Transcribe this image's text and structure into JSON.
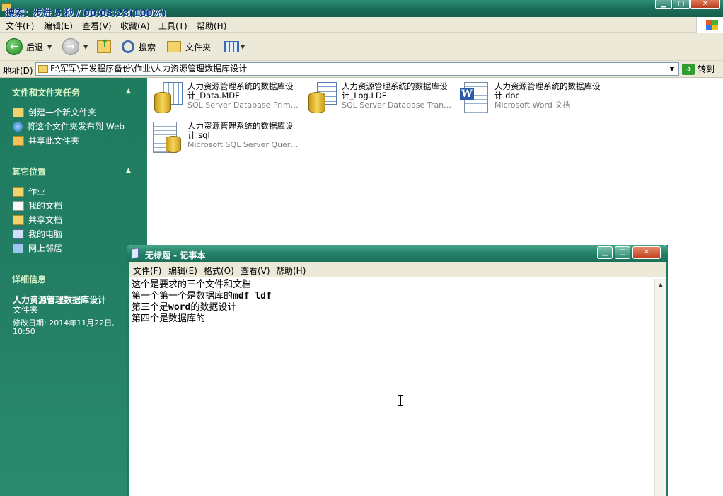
{
  "explorer": {
    "title": "搜索：步进 5 秒 / 00:03:23(100%)",
    "menu": [
      "文件(F)",
      "编辑(E)",
      "查看(V)",
      "收藏(A)",
      "工具(T)",
      "帮助(H)"
    ],
    "toolbar": {
      "back": "后退",
      "search": "搜索",
      "folders": "文件夹"
    },
    "address": {
      "label": "地址(D)",
      "path": "F:\\军军\\开发程序备份\\作业\\人力资源管理数据库设计",
      "go": "转到"
    }
  },
  "taskpane": {
    "file_tasks": {
      "title": "文件和文件夹任务",
      "items": [
        "创建一个新文件夹",
        "将这个文件夹发布到 Web",
        "共享此文件夹"
      ]
    },
    "other_places": {
      "title": "其它位置",
      "items": [
        "作业",
        "我的文档",
        "共享文档",
        "我的电脑",
        "网上邻居"
      ]
    },
    "details": {
      "title": "详细信息",
      "name": "人力资源管理数据库设计",
      "kind": "文件夹",
      "modified_1": "修改日期: 2014年11月22日,",
      "modified_2": "10:50"
    }
  },
  "files": [
    {
      "name_1": "人力资源管理系统的数据库设",
      "name_2": "计_Data.MDF",
      "type": "SQL Server Database Primary ...",
      "icon": "sql-database-icon"
    },
    {
      "name_1": "人力资源管理系统的数据库设",
      "name_2": "计_Log.LDF",
      "type": "SQL Server Database Transac...",
      "icon": "sql-log-icon"
    },
    {
      "name_1": "人力资源管理系统的数据库设",
      "name_2": "计.doc",
      "type": "Microsoft Word 文档",
      "icon": "word-document-icon"
    },
    {
      "name_1": "人力资源管理系统的数据库设",
      "name_2": "计.sql",
      "type": "Microsoft SQL Server Query File",
      "icon": "sql-query-icon"
    }
  ],
  "notepad": {
    "title": "无标题 - 记事本",
    "menu": [
      "文件(F)",
      "编辑(E)",
      "格式(O)",
      "查看(V)",
      "帮助(H)"
    ],
    "lines": [
      {
        "a": "这个是要求的三个文件和文档",
        "b": ""
      },
      {
        "a": "第一个第一个是数据库的",
        "b": "mdf ldf"
      },
      {
        "a": "第三个是",
        "b": "word",
        "c": "的数据设计"
      },
      {
        "a": "第四个是数据库的",
        "b": ""
      }
    ]
  }
}
